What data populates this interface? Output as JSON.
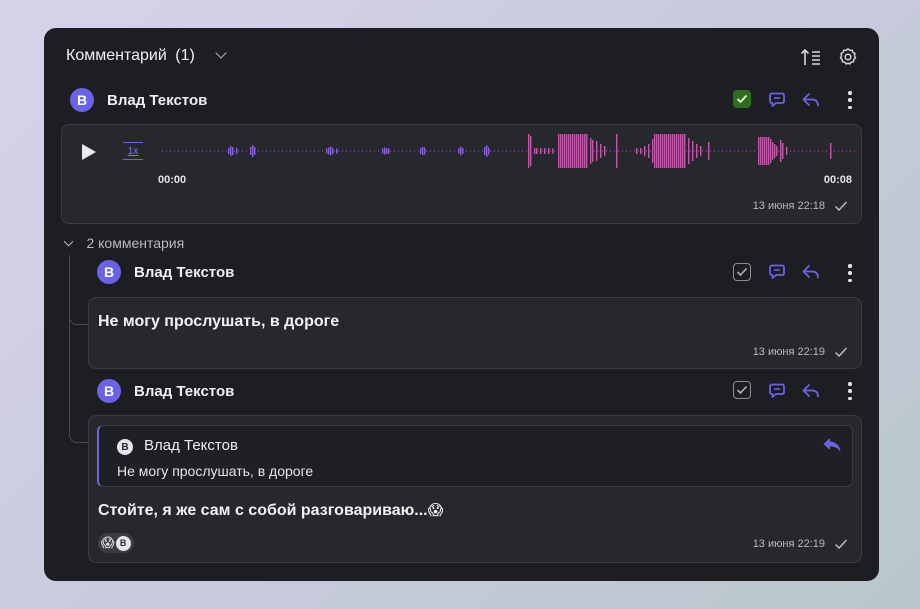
{
  "header": {
    "title": "Комментарий",
    "count": "(1)"
  },
  "main_comment": {
    "avatar_letter": "B",
    "author": "Влад Текстов",
    "approved": true,
    "audio": {
      "speed": "1x",
      "start_time": "00:00",
      "end_time": "00:08"
    },
    "timestamp": "13 июня 22:18"
  },
  "thread": {
    "label": "2 комментария",
    "replies": [
      {
        "avatar_letter": "B",
        "author": "Влад Текстов",
        "text": "Не могу прослушать, в дороге",
        "timestamp": "13 июня 22:19"
      },
      {
        "avatar_letter": "B",
        "author": "Влад Текстов",
        "quote": {
          "avatar_letter": "B",
          "author": "Влад Текстов",
          "text": "Не могу прослушать, в дороге"
        },
        "text": "Стойте, я же сам с собой разговариваю...",
        "text_emoji": "😱",
        "reaction": {
          "emoji": "😱",
          "avatar_letter": "B"
        },
        "timestamp": "13 июня 22:19"
      }
    ]
  },
  "colors": {
    "accent": "#6a63e8",
    "approved": "#2e6f1e",
    "wave_purple": "#8b62d9",
    "wave_pink": "#c05aa8"
  }
}
